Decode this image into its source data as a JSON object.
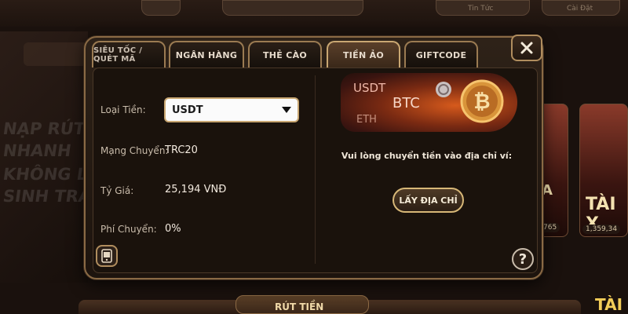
{
  "background": {
    "top_nav": [
      "Tin Tức",
      "Cài Đặt"
    ],
    "cards": [
      {
        "title": "A",
        "amount": "765"
      },
      {
        "title": "TÀI X",
        "amount": "1,359,34"
      }
    ],
    "promo_lines": [
      "NẠP RÚT",
      "NHANH",
      "KHÔNG L",
      "SINH TRẮ"
    ],
    "bottom_button": "RÚT TIỀN",
    "logo": "TÀI"
  },
  "modal": {
    "tabs": [
      {
        "label": "SIÊU TỐC / QUÉT MÃ"
      },
      {
        "label": "NGÂN HÀNG"
      },
      {
        "label": "THẺ CÀO"
      },
      {
        "label": "TIỀN ẢO"
      },
      {
        "label": "GIFTCODE"
      }
    ],
    "active_tab_index": 3,
    "form": {
      "currency_label": "Loại Tiền:",
      "currency_value": "USDT",
      "network_label": "Mạng Chuyển:",
      "network_value": "TRC20",
      "rate_label": "Tỷ Giá:",
      "rate_value": "25,194 VNĐ",
      "fee_label": "Phí Chuyển:",
      "fee_value": "0%"
    },
    "banner": {
      "usdt": "USDT",
      "btc": "BTC",
      "eth": "ETH"
    },
    "instruction": "Vui lòng chuyển tiền vào địa chỉ ví:",
    "get_address_button": "LẤY ĐỊA CHỈ",
    "help_label": "?",
    "close_icon": "close-icon",
    "colors": {
      "accent_gold": "#c9a772",
      "panel_bg": "#1a120c",
      "active_tab": "#5a3f2a"
    }
  }
}
